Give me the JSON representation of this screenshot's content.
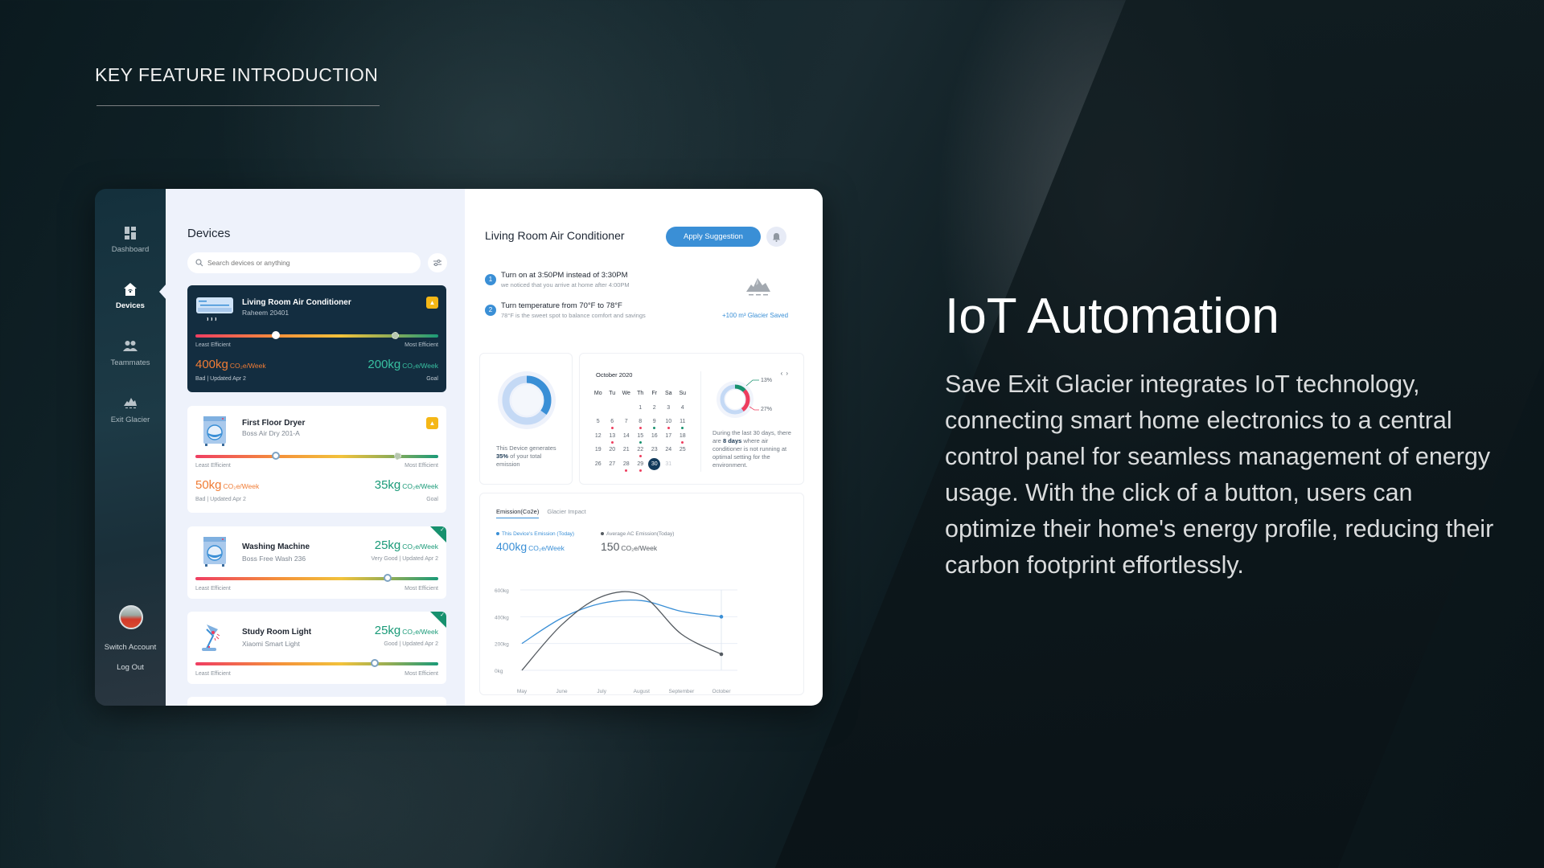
{
  "slide": {
    "heading": "KEY FEATURE INTRODUCTION",
    "feature_title": "IoT Automation",
    "feature_body": "Save Exit Glacier integrates IoT technology, connecting smart home electronics to a central control panel for seamless management of energy usage. With the click of a button, users can optimize their home's energy profile, reducing their carbon footprint effortlessly."
  },
  "sidebar": {
    "items": [
      {
        "label": "Dashboard",
        "icon": "dashboard-icon",
        "active": false
      },
      {
        "label": "Devices",
        "icon": "smart-home-icon",
        "active": true
      },
      {
        "label": "Teammates",
        "icon": "teammates-icon",
        "active": false
      },
      {
        "label": "Exit Glacier",
        "icon": "glacier-icon",
        "active": false
      }
    ],
    "switch_account": "Switch Account",
    "log_out": "Log Out"
  },
  "devices": {
    "title": "Devices",
    "search_placeholder": "Search devices or anything",
    "least_label": "Least Efficient",
    "most_label": "Most Efficient",
    "unit": "CO₂e/Week",
    "cards": [
      {
        "name": "Living Room Air Conditioner",
        "model": "Raheem 20401",
        "icon": "air-conditioner-icon",
        "status_badge": "warning",
        "efficiency": 0.33,
        "goal_efficiency": 0.82,
        "value": "400kg",
        "status": "Bad | Updated Apr 2",
        "goal_value": "200kg",
        "goal_label": "Goal",
        "selected": true
      },
      {
        "name": "First Floor Dryer",
        "model": "Boss Air Dry 201-A",
        "icon": "dryer-icon",
        "status_badge": "warning",
        "efficiency": 0.33,
        "goal_efficiency": 0.83,
        "value": "50kg",
        "status": "Bad | Updated Apr 2",
        "goal_value": "35kg",
        "goal_label": "Goal",
        "selected": false
      },
      {
        "name": "Washing Machine",
        "model": "Boss Free Wash 236",
        "icon": "washing-machine-icon",
        "status_badge": "good",
        "efficiency": 0.79,
        "value": "25kg",
        "status": "Very Good | Updated Apr 2",
        "selected": false
      },
      {
        "name": "Study Room Light",
        "model": "Xiaomi Smart Light",
        "icon": "desk-lamp-icon",
        "status_badge": "good",
        "efficiency": 0.74,
        "value": "25kg",
        "status": "Good | Updated Apr 2",
        "selected": false
      }
    ]
  },
  "detail": {
    "title": "Living Room Air Conditioner",
    "apply_label": "Apply Suggestion",
    "suggestions": [
      {
        "num": "1",
        "title": "Turn on at 3:50PM instead of 3:30PM",
        "sub": "we noticed that you arrive at home after 4:00PM"
      },
      {
        "num": "2",
        "title": "Turn temperature from 70°F to 78°F",
        "sub": "78°F is the sweet spot to balance comfort and savings"
      }
    ],
    "glacier_saved": "+100 m³ Glacier Saved",
    "share": {
      "pre": "This Device generates ",
      "pct": "35%",
      "post": " of your total emission",
      "value": 0.35
    },
    "calendar": {
      "title": "October 2020",
      "nav": "‹ ›",
      "weekdays": [
        "Mo",
        "Tu",
        "We",
        "Th",
        "Fr",
        "Sa",
        "Su"
      ],
      "weeks": [
        [
          "",
          "",
          "",
          "1",
          "2",
          "3",
          "4"
        ],
        [
          "5",
          "6",
          "7",
          "8",
          "9",
          "10",
          "11"
        ],
        [
          "12",
          "13",
          "14",
          "15",
          "16",
          "17",
          "18"
        ],
        [
          "19",
          "20",
          "21",
          "22",
          "23",
          "24",
          "25"
        ],
        [
          "26",
          "27",
          "28",
          "29",
          "30",
          "31",
          ""
        ]
      ],
      "red_days": [
        "6",
        "8",
        "10",
        "13",
        "18",
        "22",
        "28",
        "29"
      ],
      "green_days": [
        "9",
        "11",
        "15"
      ],
      "selected_day": "30",
      "muted_days": [
        "31"
      ]
    },
    "optimal": {
      "green_pct": "13%",
      "red_pct": "27%",
      "green_value": 0.13,
      "red_value": 0.27,
      "pre": "During the last 30 days, there are ",
      "days": "8 days",
      "post": " where air conditioner is not running at optimal setting for the environment."
    },
    "tabs": [
      "Emission(Co2e)",
      "Glacier Impact"
    ],
    "legend": [
      {
        "label": "This Device's Emission (Today)",
        "value": "400kg",
        "unit": "CO₂e/Week",
        "color": "#3a8fd6"
      },
      {
        "label": "Average AC Emission(Today)",
        "value": "150",
        "unit": "CO₂e/Week",
        "color": "#555b61"
      }
    ]
  },
  "chart_data": {
    "type": "line",
    "title": "",
    "xlabel": "",
    "ylabel": "",
    "categories": [
      "May",
      "June",
      "July",
      "August",
      "September",
      "October"
    ],
    "y_ticks": [
      "0kg",
      "200kg",
      "400kg",
      "600kg"
    ],
    "ylim": [
      0,
      600
    ],
    "grid": true,
    "series": [
      {
        "name": "This Device's Emission",
        "color": "#3a8fd6",
        "values": [
          200,
          390,
          500,
          520,
          440,
          400
        ]
      },
      {
        "name": "Average AC Emission",
        "color": "#555b61",
        "values": [
          0,
          340,
          550,
          560,
          270,
          120
        ]
      }
    ]
  }
}
